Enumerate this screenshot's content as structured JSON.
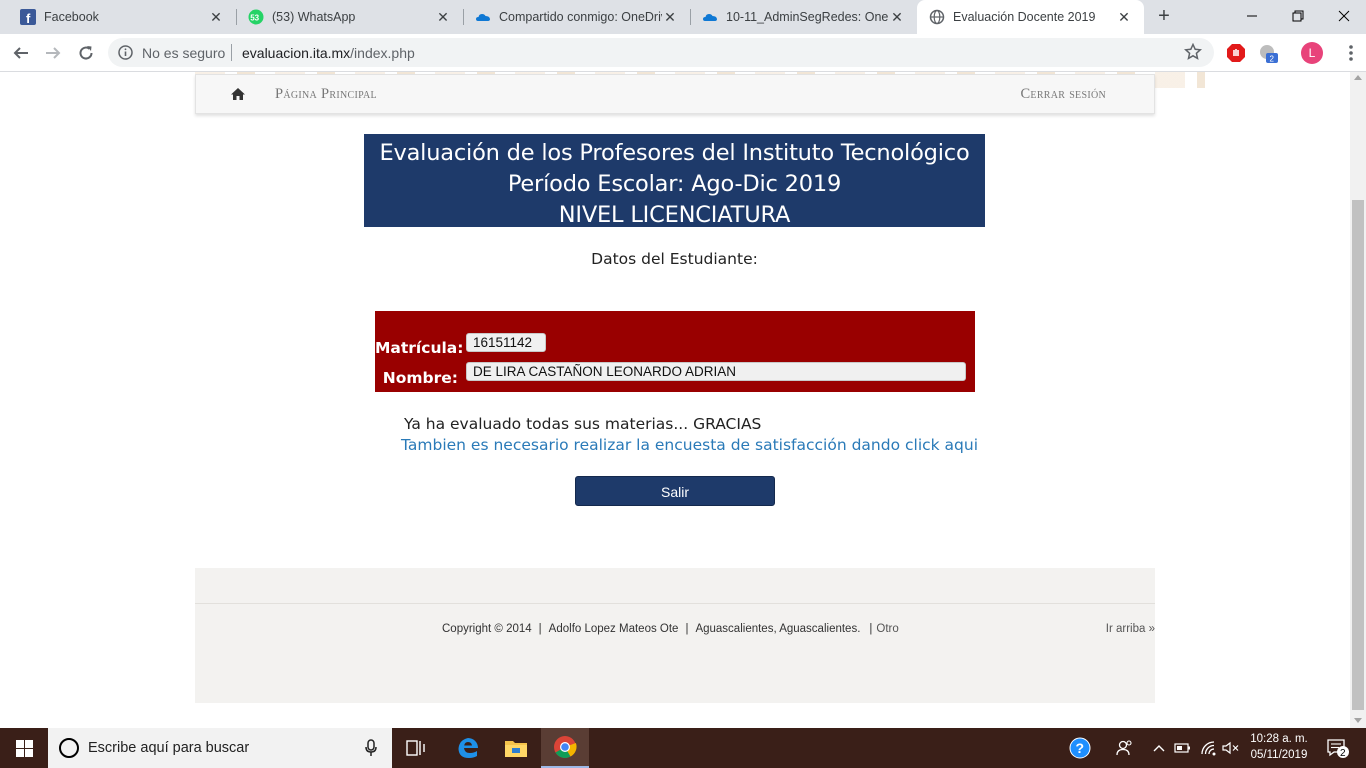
{
  "browser": {
    "tabs": [
      {
        "title": "Facebook",
        "icon": "facebook-icon"
      },
      {
        "title": "(53) WhatsApp",
        "icon": "whatsapp-icon",
        "badge": "53"
      },
      {
        "title": "Compartido conmigo: OneDriv",
        "icon": "onedrive-icon"
      },
      {
        "title": "10-11_AdminSegRedes: OneDr",
        "icon": "onedrive-icon"
      },
      {
        "title": "Evaluación Docente 2019",
        "icon": "globe-icon",
        "active": true
      }
    ],
    "security_label": "No es seguro",
    "url_host": "evaluacion.ita.mx",
    "url_path": "/index.php",
    "profile_initial": "L",
    "extension_badge": "2"
  },
  "nav": {
    "home_label": "Página Principal",
    "logout_label": "Cerrar sesión"
  },
  "banner": {
    "line1": "Evaluación de los Profesores del Instituto Tecnológico",
    "line2": "Período Escolar: Ago-Dic 2019",
    "line3": "NIVEL LICENCIATURA"
  },
  "student": {
    "heading": "Datos del Estudiante:",
    "matricula_label": "Matrícula:",
    "matricula_value": "16151142",
    "nombre_label": "Nombre:",
    "nombre_value": "DE LIRA CASTAÑON LEONARDO ADRIAN"
  },
  "messages": {
    "done": "Ya ha evaluado todas sus materias... GRACIAS",
    "survey_link": "Tambien es necesario realizar la encuesta de satisfacción dando click aqui"
  },
  "actions": {
    "exit_label": "Salir"
  },
  "footer": {
    "copyright": "Copyright © 2014",
    "address": "Adolfo Lopez Mateos Ote",
    "city": "Aguascalientes, Aguascalientes.",
    "other": "Otro",
    "back_to_top": "Ir arriba »"
  },
  "taskbar": {
    "search_placeholder": "Escribe aquí para buscar",
    "time": "10:28 a. m.",
    "date": "05/11/2019",
    "notifications_count": "2"
  },
  "colors": {
    "banner_bg": "#1e3a6a",
    "student_box_bg": "#990000",
    "link": "#2a7ab8",
    "button_bg": "#1e3a6a"
  }
}
